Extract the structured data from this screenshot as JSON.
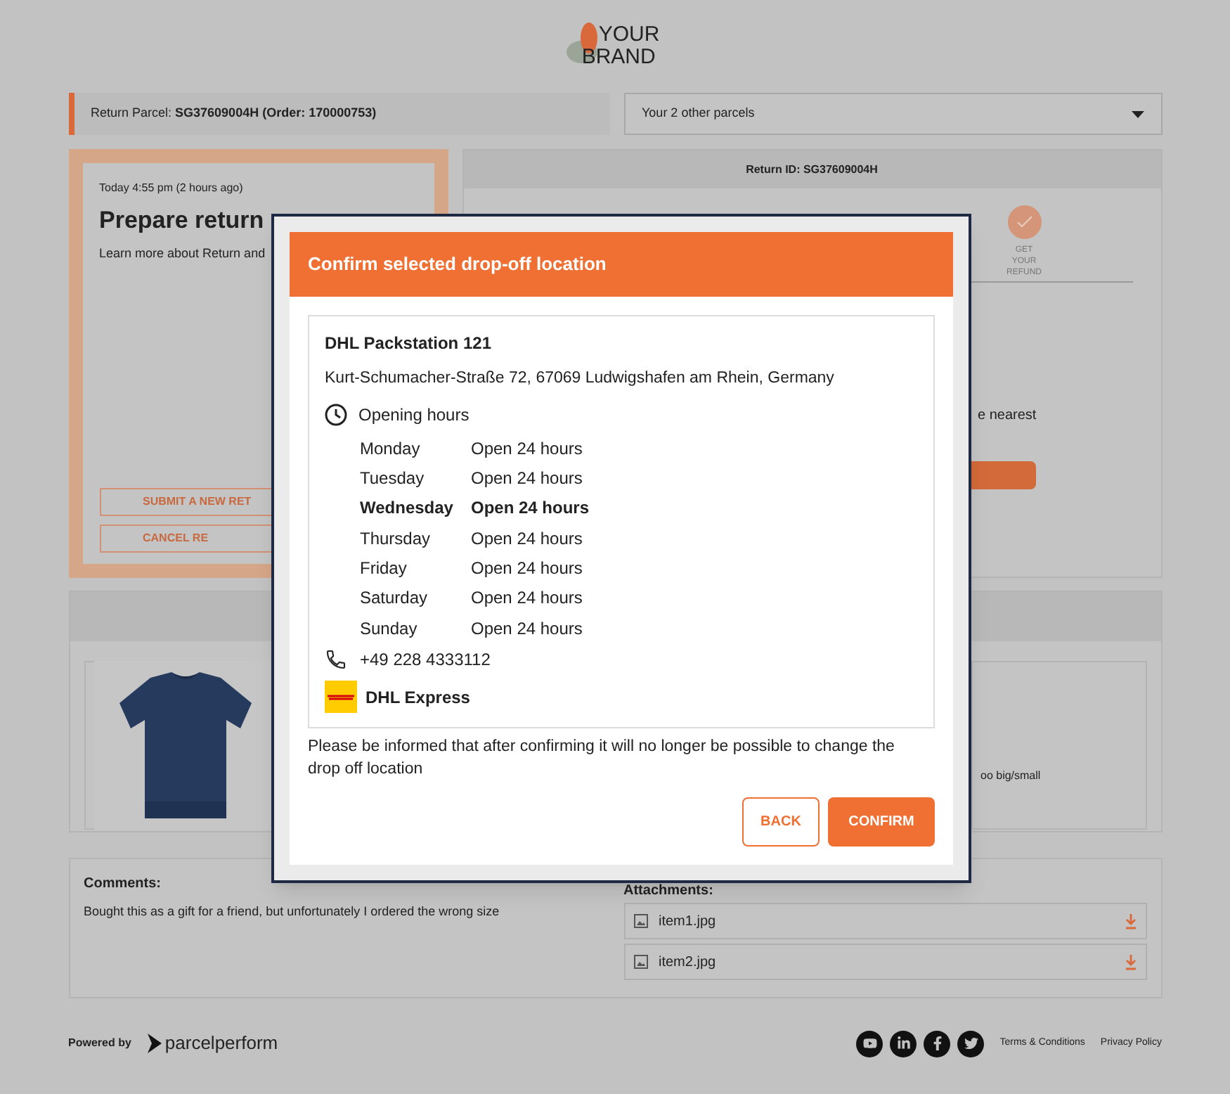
{
  "brand": {
    "line1": "YOUR",
    "line2": "BRAND"
  },
  "parcel_bar": {
    "label": "Return Parcel: **SG37609004H (Order: 170000753)**",
    "other_parcels": "Your 2 other parcels"
  },
  "status_card": {
    "time": "Today 4:55 pm (2 hours ago)",
    "title": "Prepare return",
    "text": "Learn more about Return and",
    "buttons": [
      "SUBMIT A NEW RET",
      "CANCEL RE"
    ]
  },
  "progress": {
    "return_id": "Return ID: SG37609004H",
    "step": "GET YOUR REFUND",
    "hint": "e nearest"
  },
  "product": {
    "reason": "oo big/small"
  },
  "comments": {
    "title": "Comments:",
    "text": "Bought this as a gift for a friend, but unfortunately I ordered the wrong size"
  },
  "attachments": {
    "title": "Attachments:",
    "files": [
      "item1.jpg",
      "item2.jpg"
    ]
  },
  "footer": {
    "powered_by": "Powered by",
    "provider": "parcelperform",
    "links": [
      "Terms & Conditions",
      "Privacy Policy"
    ]
  },
  "dialog": {
    "title": "Confirm selected drop-off location",
    "name": "DHL Packstation 121",
    "address": "Kurt-Schumacher-Straße 72, 67069 Ludwigshafen am Rhein, Germany",
    "hours_title": "Opening hours",
    "hours": [
      {
        "day": "Monday",
        "hours": "Open 24 hours",
        "current": false
      },
      {
        "day": "Tuesday",
        "hours": "Open 24 hours",
        "current": false
      },
      {
        "day": "Wednesday",
        "hours": "Open 24 hours",
        "current": true
      },
      {
        "day": "Thursday",
        "hours": "Open 24 hours",
        "current": false
      },
      {
        "day": "Friday",
        "hours": "Open 24 hours",
        "current": false
      },
      {
        "day": "Saturday",
        "hours": "Open 24 hours",
        "current": false
      },
      {
        "day": "Sunday",
        "hours": "Open 24 hours",
        "current": false
      }
    ],
    "phone": "+49 228 4333112",
    "carrier": "DHL Express",
    "notice": "Please be informed that after confirming it will no longer be possible to change the drop off location",
    "buttons": [
      {
        "label": "BACK",
        "kind": "outline"
      },
      {
        "label": "CONFIRM",
        "kind": "primary"
      }
    ]
  }
}
